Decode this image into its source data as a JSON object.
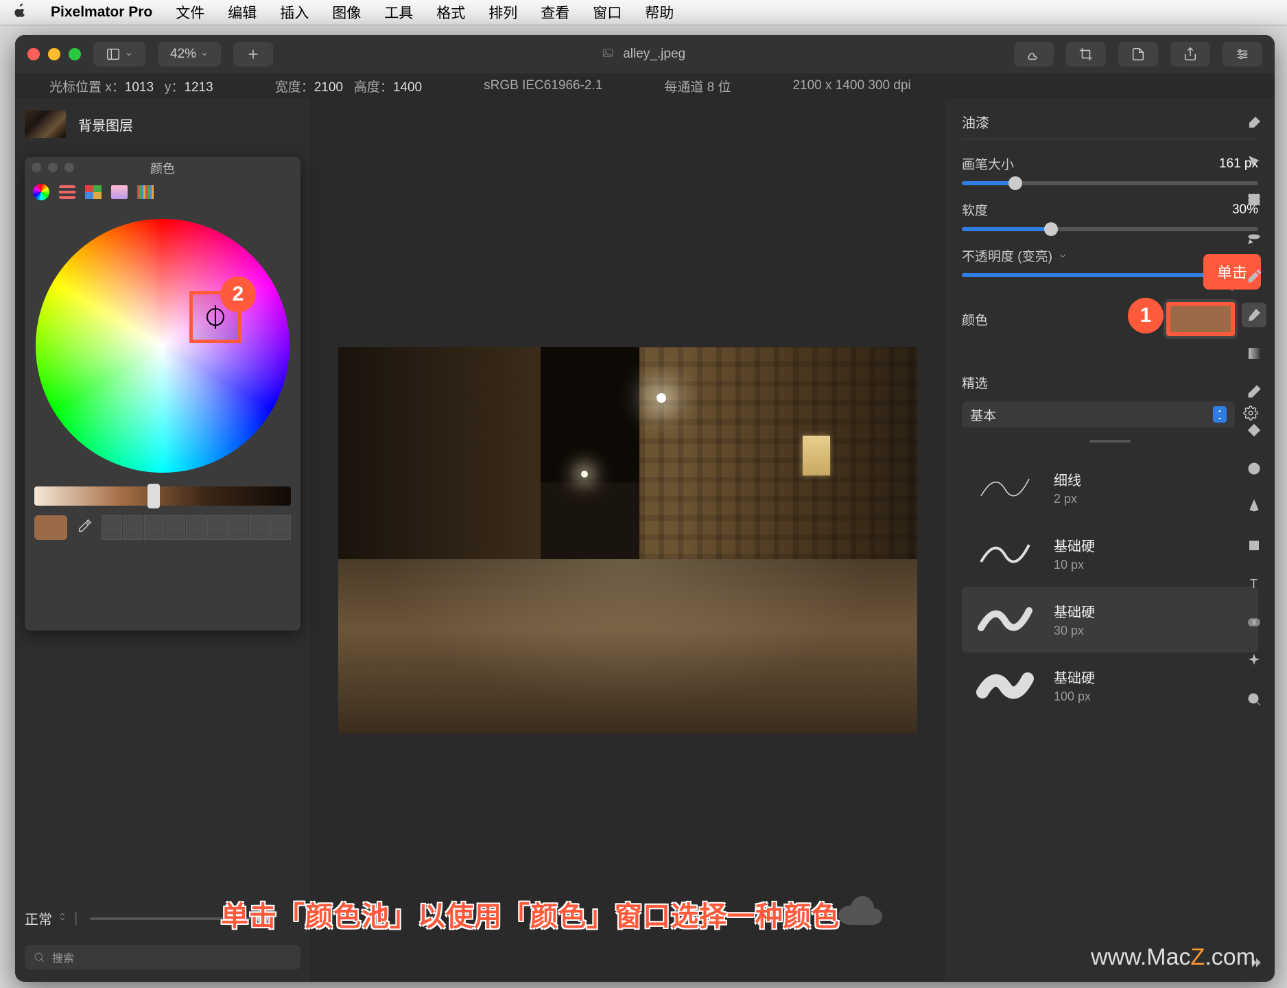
{
  "menubar": {
    "app_name": "Pixelmator Pro",
    "items": [
      "文件",
      "编辑",
      "插入",
      "图像",
      "工具",
      "格式",
      "排列",
      "查看",
      "窗口",
      "帮助"
    ]
  },
  "toolbar": {
    "zoom": "42%",
    "filename": "alley_.jpeg"
  },
  "infobar": {
    "cursor_label": "光标位置 x：",
    "cursor_x": "1013",
    "cursor_y_label": "y：",
    "cursor_y": "1213",
    "width_label": "宽度：",
    "width": "2100",
    "height_label": "高度：",
    "height": "1400",
    "colorspace": "sRGB IEC61966-2.1",
    "depth": "每通道 8 位",
    "dims": "2100 x 1400 300 dpi"
  },
  "layers": {
    "bg_name": "背景图层",
    "blend_mode": "正常",
    "search_placeholder": "搜索"
  },
  "colors_popup": {
    "title": "颜色"
  },
  "paint_panel": {
    "title": "油漆",
    "brush_size_label": "画笔大小",
    "brush_size_value": "161 px",
    "softness_label": "软度",
    "softness_value": "30%",
    "opacity_label": "不透明度 (变亮)",
    "color_label": "颜色",
    "select_label": "精选",
    "preset_group": "基本",
    "brushes": [
      {
        "name": "细线",
        "size": "2 px"
      },
      {
        "name": "基础硬",
        "size": "10 px"
      },
      {
        "name": "基础硬",
        "size": "30 px"
      },
      {
        "name": "基础硬",
        "size": "100 px"
      }
    ]
  },
  "callouts": {
    "tooltip": "单击",
    "num1": "1",
    "num2": "2",
    "instruction": "单击「颜色池」以使用「颜色」窗口选择一种颜色"
  },
  "watermark": {
    "prefix": "www.Mac",
    "accent": "Z",
    "suffix": ".com"
  }
}
